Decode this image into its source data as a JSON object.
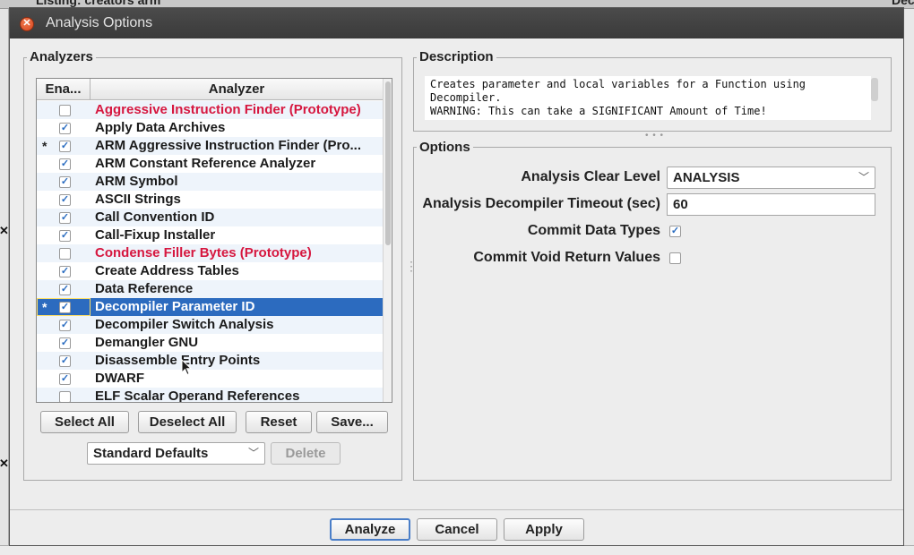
{
  "background": {
    "title": "Listing: creators arm",
    "right_title": "Dec",
    "close_marks": [
      "✕",
      "✕"
    ]
  },
  "dialog": {
    "title": "Analysis Options",
    "close_glyph": "✕"
  },
  "analyzers": {
    "group_label": "Analyzers",
    "columns": {
      "enabled": "Ena...",
      "analyzer": "Analyzer"
    },
    "rows": [
      {
        "mark": "",
        "checked": false,
        "name": "Aggressive Instruction Finder (Prototype)",
        "prototype": true,
        "selected": false
      },
      {
        "mark": "",
        "checked": true,
        "name": "Apply Data Archives",
        "prototype": false,
        "selected": false
      },
      {
        "mark": "*",
        "checked": true,
        "name": "ARM Aggressive Instruction Finder (Pro...",
        "prototype": false,
        "selected": false
      },
      {
        "mark": "",
        "checked": true,
        "name": "ARM Constant Reference Analyzer",
        "prototype": false,
        "selected": false
      },
      {
        "mark": "",
        "checked": true,
        "name": "ARM Symbol",
        "prototype": false,
        "selected": false
      },
      {
        "mark": "",
        "checked": true,
        "name": "ASCII Strings",
        "prototype": false,
        "selected": false
      },
      {
        "mark": "",
        "checked": true,
        "name": "Call Convention ID",
        "prototype": false,
        "selected": false
      },
      {
        "mark": "",
        "checked": true,
        "name": "Call-Fixup Installer",
        "prototype": false,
        "selected": false
      },
      {
        "mark": "",
        "checked": false,
        "name": "Condense Filler Bytes (Prototype)",
        "prototype": true,
        "selected": false
      },
      {
        "mark": "",
        "checked": true,
        "name": "Create Address Tables",
        "prototype": false,
        "selected": false
      },
      {
        "mark": "",
        "checked": true,
        "name": "Data Reference",
        "prototype": false,
        "selected": false
      },
      {
        "mark": "*",
        "checked": true,
        "name": "Decompiler Parameter ID",
        "prototype": false,
        "selected": true
      },
      {
        "mark": "",
        "checked": true,
        "name": "Decompiler Switch Analysis",
        "prototype": false,
        "selected": false
      },
      {
        "mark": "",
        "checked": true,
        "name": "Demangler GNU",
        "prototype": false,
        "selected": false
      },
      {
        "mark": "",
        "checked": true,
        "name": "Disassemble Entry Points",
        "prototype": false,
        "selected": false
      },
      {
        "mark": "",
        "checked": true,
        "name": "DWARF",
        "prototype": false,
        "selected": false
      },
      {
        "mark": "",
        "checked": false,
        "name": "ELF Scalar Operand References",
        "prototype": false,
        "selected": false
      }
    ],
    "buttons": {
      "select_all": "Select All",
      "deselect_all": "Deselect All",
      "reset": "Reset",
      "save": "Save..."
    },
    "profile_select": "Standard Defaults",
    "delete_label": "Delete"
  },
  "description": {
    "group_label": "Description",
    "lines": [
      "Creates parameter and local variables for a Function using",
      "Decompiler.",
      "WARNING: This can take a SIGNIFICANT Amount of Time!"
    ]
  },
  "options": {
    "group_label": "Options",
    "clear_level_label": "Analysis Clear Level",
    "clear_level_value": "ANALYSIS",
    "timeout_label": "Analysis Decompiler Timeout (sec)",
    "timeout_value": "60",
    "commit_types_label": "Commit Data Types",
    "commit_types_checked": true,
    "commit_void_label": "Commit Void Return Values",
    "commit_void_checked": false
  },
  "footer": {
    "analyze": "Analyze",
    "cancel": "Cancel",
    "apply": "Apply"
  },
  "icons": {
    "check": "✓",
    "chevron": "﹀",
    "splitter_h": "• • •",
    "splitter_v": "⋮"
  }
}
